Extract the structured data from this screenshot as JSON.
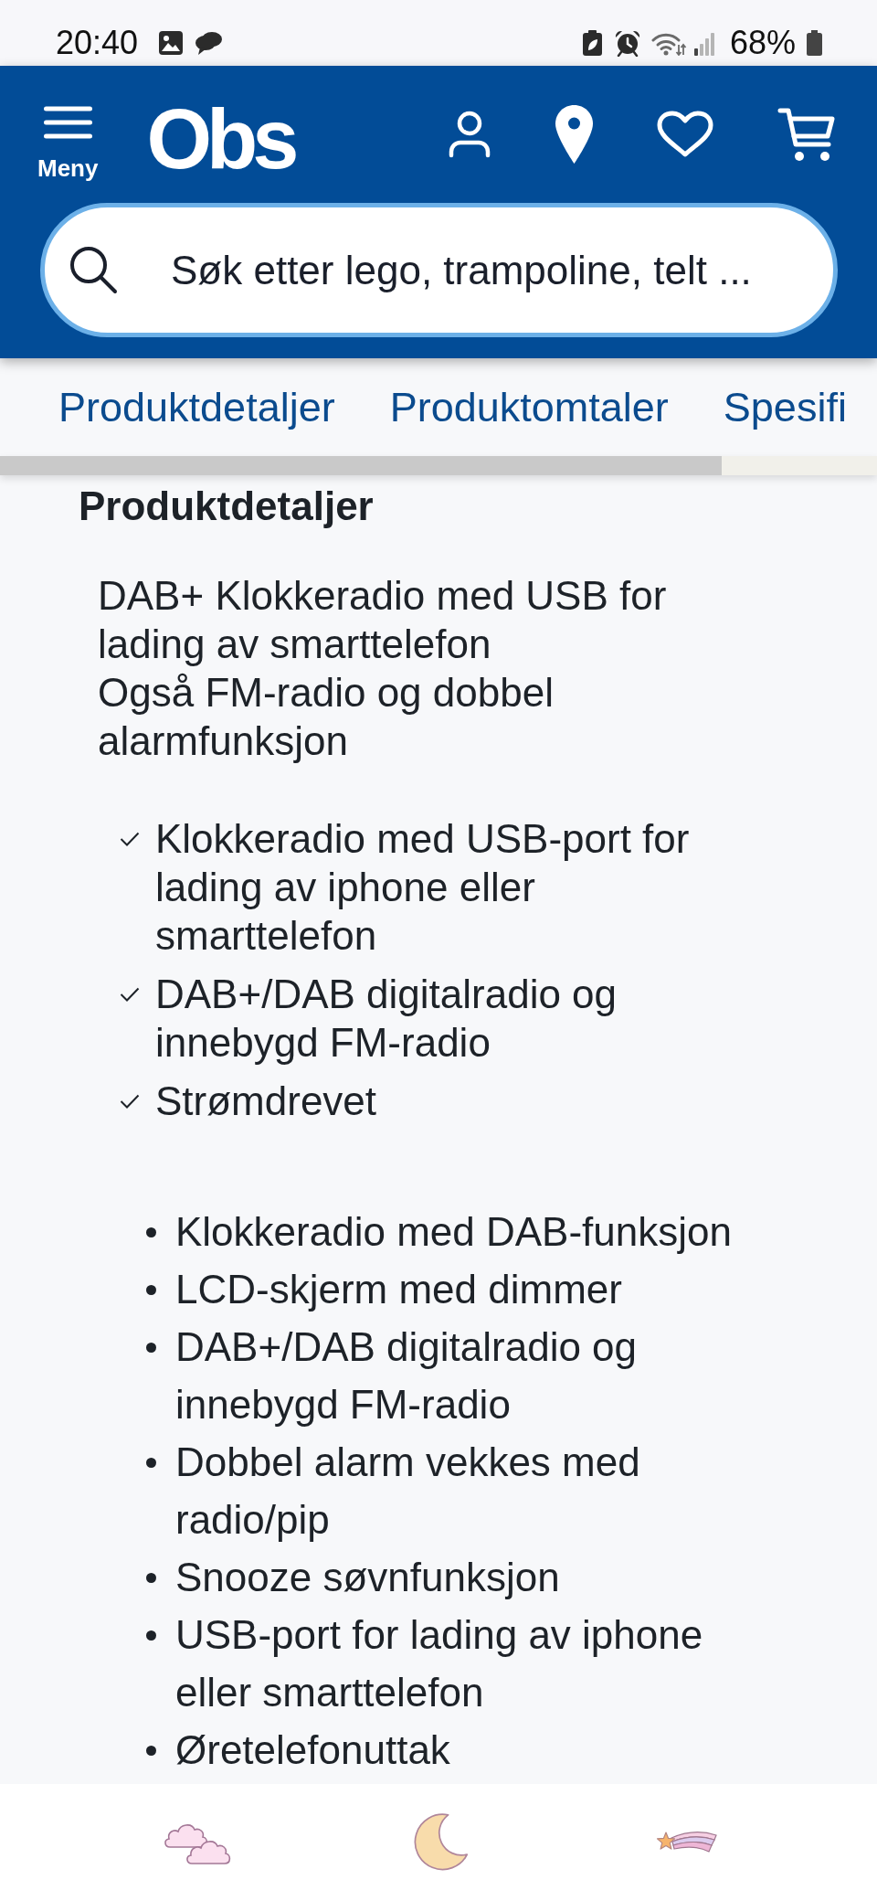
{
  "status_bar": {
    "time": "20:40",
    "battery": "68%"
  },
  "header": {
    "menu_label": "Meny",
    "logo": "Obs",
    "search": {
      "placeholder": "Søk etter lego, trampoline, telt ..."
    }
  },
  "section_tabs": [
    {
      "label": "Produktdetaljer"
    },
    {
      "label": "Produktomtaler"
    },
    {
      "label": "Spesifi"
    }
  ],
  "product_details": {
    "heading": "Produktdetaljer",
    "description": [
      "DAB+ Klokkeradio med USB for lading av smarttelefon",
      "Også FM-radio og dobbel alarmfunksjon"
    ],
    "highlights": [
      "Klokkeradio med USB-port for lading av iphone eller smarttelefon",
      "DAB+/DAB digitalradio og innebygd FM-radio",
      "Strømdrevet"
    ],
    "features": [
      "Klokkeradio med DAB-funksjon",
      "LCD-skjerm med dimmer",
      "DAB+/DAB digitalradio og innebygd FM-radio",
      "Dobbel alarm vekkes med radio/pip",
      "Snooze søvnfunksjon",
      "USB-port for lading av iphone eller smarttelefon",
      "Øretelefonuttak"
    ]
  }
}
